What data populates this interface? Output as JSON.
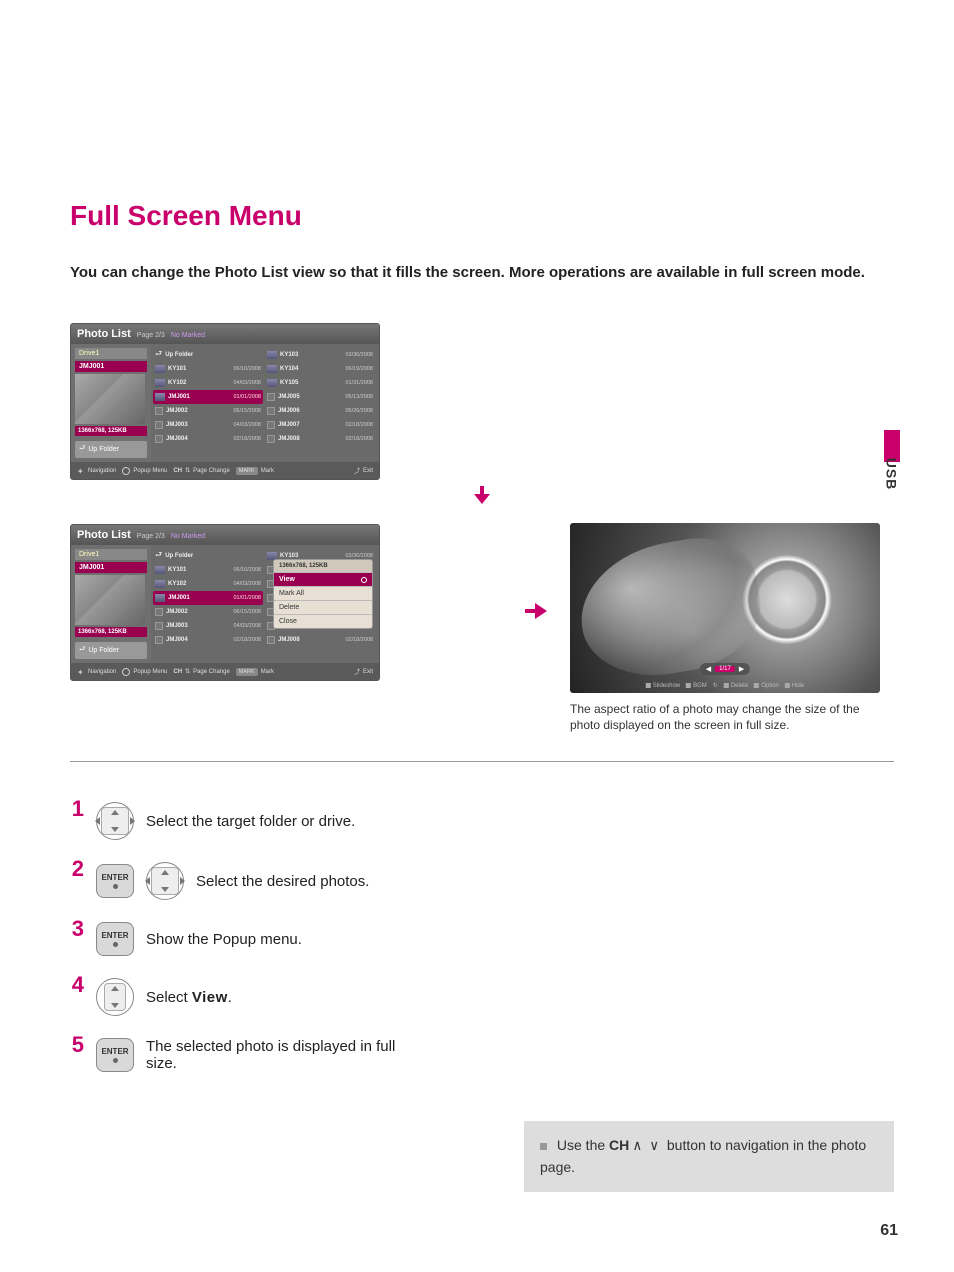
{
  "sideTab": "USB",
  "title": "Full Screen Menu",
  "intro": "You can change the Photo List view so that it fills the screen. More operations are available in full screen mode.",
  "screen1": {
    "header": {
      "title": "Photo List",
      "page": "Page 2/3",
      "marked": "No Marked"
    },
    "sidebar": {
      "drive": "Drive1",
      "sel": "JMJ001",
      "res": "1366x768, 125KB",
      "up": "Up Folder"
    },
    "col1": [
      {
        "name": "Up Folder",
        "date": "",
        "up": true
      },
      {
        "name": "KY101",
        "date": "06/10/2008"
      },
      {
        "name": "KY102",
        "date": "04/03/2008"
      },
      {
        "name": "JMJ001",
        "date": "01/01/2008",
        "hi": true
      },
      {
        "name": "JMJ002",
        "date": "06/15/2008",
        "ck": true
      },
      {
        "name": "JMJ003",
        "date": "04/03/2008",
        "ck": true
      },
      {
        "name": "JMJ004",
        "date": "02/18/2008",
        "ck": true
      }
    ],
    "col2": [
      {
        "name": "KY103",
        "date": "03/30/2008"
      },
      {
        "name": "KY104",
        "date": "06/19/2008"
      },
      {
        "name": "KY105",
        "date": "01/31/2008"
      },
      {
        "name": "JMJ005",
        "date": "05/13/2008",
        "ck": true
      },
      {
        "name": "JMJ006",
        "date": "05/26/2008",
        "ck": true
      },
      {
        "name": "JMJ007",
        "date": "02/18/2008",
        "ck": true
      },
      {
        "name": "JMJ008",
        "date": "02/18/2008",
        "ck": true
      }
    ],
    "footer": {
      "nav": "Navigation",
      "popup": "Popup Menu",
      "ch": "CH",
      "page": "Page Change",
      "markKey": "MARK",
      "mark": "Mark",
      "exit": "Exit"
    }
  },
  "screen2": {
    "header": {
      "title": "Photo List",
      "page": "Page 2/3",
      "marked": "No Marked"
    },
    "sidebar": {
      "drive": "Drive1",
      "sel": "JMJ001",
      "res": "1366x768, 125KB",
      "up": "Up Folder"
    },
    "col1": [
      {
        "name": "Up Folder",
        "date": "",
        "up": true
      },
      {
        "name": "KY101",
        "date": "06/10/2008"
      },
      {
        "name": "KY102",
        "date": "04/03/2008"
      },
      {
        "name": "JMJ001",
        "date": "01/01/2008",
        "hi": true
      },
      {
        "name": "JMJ002",
        "date": "06/15/2008",
        "ck": true
      },
      {
        "name": "JMJ003",
        "date": "04/03/2008",
        "ck": true
      },
      {
        "name": "JMJ004",
        "date": "02/18/2008",
        "ck": true
      }
    ],
    "col2": [
      {
        "name": "KY103",
        "date": "03/30/2008"
      },
      {
        "name": "JMJ008",
        "date": "02/18/2008",
        "ck": true,
        "last": true
      }
    ],
    "popup": {
      "res": "1366x768, 125KB",
      "items": [
        "View",
        "Mark All",
        "Delete",
        "Close"
      ],
      "sel": "View"
    },
    "footer": {
      "nav": "Navigation",
      "popup": "Popup Menu",
      "ch": "CH",
      "page": "Page Change",
      "markKey": "MARK",
      "mark": "Mark",
      "exit": "Exit"
    }
  },
  "photoView": {
    "page": "1/17",
    "actions": [
      "Slideshow",
      "BGM",
      "Delete",
      "Option",
      "Hide"
    ],
    "rotateIcon": "↻"
  },
  "note": "The aspect ratio of a photo may change the size of the photo displayed on the screen in full size.",
  "steps": {
    "s1": "Select the target folder or drive.",
    "s2": "Select the desired photos.",
    "s3": "Show the Popup menu.",
    "s4_pre": "Select ",
    "s4_kw": "View",
    "s4_post": ".",
    "s5": "The selected photo is displayed in full size.",
    "enter": "ENTER"
  },
  "info": {
    "pre": "Use the ",
    "ch": "CH",
    "arrows": " ∧ ∨ ",
    "post": "button to navigation in the photo page."
  },
  "pageNum": "61"
}
